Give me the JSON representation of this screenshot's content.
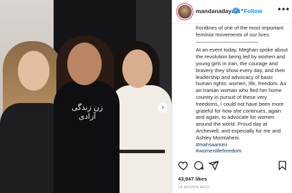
{
  "post": {
    "image_alt": "Three women posing together",
    "shirt_text": "زن زندگی آزادی",
    "next_icon": "chevron-right-icon"
  },
  "header": {
    "username": "mandanadayani",
    "separator": "•",
    "follow_label": "Follow",
    "more_icon": "•••"
  },
  "caption": {
    "line1": "frontlines of one of the most important feminist movements of our lives.",
    "rule": "————————————",
    "body": "At an event today, Meghan spoke about the revolution being led by women and young girls in Iran, the courage and bravery they show every day, and their leadership and advocacy of basic human rights: women, life, freedom. As an Iranian woman who fled her home country in pursuit of these very freedoms, I could not have been more grateful for how she continues, again and again, to advocate for women around the world. Proud day at Archewell, and especially for me and Ashley Momtaheni.",
    "hashtag1": "#mahsaamini",
    "hashtag2": "#womenlifefreedom"
  },
  "actions": {
    "like_icon": "heart-icon",
    "comment_icon": "comment-icon",
    "share_icon": "share-icon",
    "save_icon": "bookmark-icon"
  },
  "stats": {
    "likes": "43,947 likes",
    "time": "14 HOURS AGO"
  },
  "colors": {
    "follow": "#0095f6",
    "hashtag": "#00376b",
    "text": "#262626"
  }
}
